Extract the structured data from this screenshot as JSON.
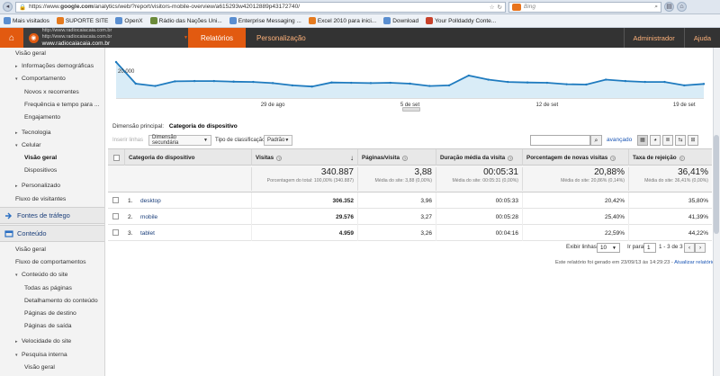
{
  "browser": {
    "url_prefix": "https://www.",
    "url_domain": "google.com",
    "url_rest": "/analytics/web/?report/visitors-mobile-overview/a615293w42012889p43172740/",
    "search_placeholder": "Bing",
    "bookmarks": [
      "Mais visitados",
      "SUPORTE SITE",
      "OpenX",
      "Rádio das Nações Uni...",
      "Enterprise Messaging ...",
      "Excel 2010 para inici...",
      "Download",
      "Your Polldaddy Conte..."
    ]
  },
  "ga": {
    "home_icon": "home-icon",
    "site_url_small": "http://www.radiocaiacaia.com.br  http://www.radiocaiacaia.com.br",
    "site_url": "www.radiocaiacaia.com.br",
    "tabs": [
      "Relatórios",
      "Personalização"
    ],
    "right": [
      "Administrador",
      "Ajuda"
    ]
  },
  "sidebar": {
    "items": [
      {
        "label": "Visão geral"
      },
      {
        "label": "Informações demográficas"
      },
      {
        "label": "Comportamento"
      },
      {
        "label": "Novos x recorrentes"
      },
      {
        "label": "Frequência e tempo para ..."
      },
      {
        "label": "Engajamento"
      },
      {
        "label": "Tecnologia"
      },
      {
        "label": "Celular"
      },
      {
        "label": "Visão geral"
      },
      {
        "label": "Dispositivos"
      },
      {
        "label": "Personalizado"
      },
      {
        "label": "Fluxo de visitantes"
      },
      {
        "label": "Fontes de tráfego"
      },
      {
        "label": "Conteúdo"
      },
      {
        "label": "Visão geral"
      },
      {
        "label": "Fluxo de comportamentos"
      },
      {
        "label": "Conteúdo do site"
      },
      {
        "label": "Todas as páginas"
      },
      {
        "label": "Detalhamento do conteúdo"
      },
      {
        "label": "Páginas de destino"
      },
      {
        "label": "Páginas de saída"
      },
      {
        "label": "Velocidade do site"
      },
      {
        "label": "Pesquisa interna"
      },
      {
        "label": "Visão geral"
      }
    ]
  },
  "chart_data": {
    "type": "line",
    "y_label_visible": "20.000",
    "x_ticks": [
      "29 de ago",
      "5 de set",
      "12 de set",
      "19 de set"
    ],
    "values": [
      22500,
      15000,
      14200,
      15800,
      15900,
      15900,
      15700,
      15600,
      15200,
      14400,
      14000,
      15400,
      15300,
      15200,
      15300,
      15000,
      14200,
      14400,
      17800,
      16400,
      15600,
      15400,
      15300,
      14800,
      14700,
      16400,
      15900,
      15600,
      15600,
      14400,
      14900
    ]
  },
  "controls": {
    "primary_dimension_label": "Dimensão principal:",
    "primary_dimension_value": "Categoria do dispositivo",
    "plot_rows": "Inserir linhas",
    "secondary_dim": "Dimensão secundária",
    "sort_label": "Tipo de classificação:",
    "sort_value": "Padrão",
    "advanced": "avançado"
  },
  "table": {
    "headers": [
      "Categoria do dispositivo",
      "Visitas",
      "Páginas/visita",
      "Duração média da visita",
      "Porcentagem de novas visitas",
      "Taxa de rejeição"
    ],
    "totals": [
      {
        "big": "340.887",
        "sub": "Porcentagem do total: 100,00% (340.887)"
      },
      {
        "big": "3,88",
        "sub": "Média do site: 3,88 (0,00%)"
      },
      {
        "big": "00:05:31",
        "sub": "Média do site: 00:05:31 (0,00%)"
      },
      {
        "big": "20,88%",
        "sub": "Média do site: 20,86% (0,14%)"
      },
      {
        "big": "36,41%",
        "sub": "Média do site: 36,41% (0,00%)"
      }
    ],
    "rows": [
      {
        "n": "1.",
        "cat": "desktop",
        "visits": "306.352",
        "ppv": "3,96",
        "dur": "00:05:33",
        "new": "20,42%",
        "bounce": "35,80%"
      },
      {
        "n": "2.",
        "cat": "mobile",
        "visits": "29.576",
        "ppv": "3,27",
        "dur": "00:05:28",
        "new": "25,40%",
        "bounce": "41,39%"
      },
      {
        "n": "3.",
        "cat": "tablet",
        "visits": "4.959",
        "ppv": "3,26",
        "dur": "00:04:16",
        "new": "22,59%",
        "bounce": "44,22%"
      }
    ]
  },
  "pager": {
    "show_rows_label": "Exibir linhas:",
    "show_rows_value": "10",
    "goto_label": "Ir para:",
    "goto_value": "1",
    "range": "1 - 3 de 3"
  },
  "footer": {
    "generated": "Este relatório foi gerado em 23/09/13 às 14:29:23 -",
    "refresh": "Atualizar relatório"
  }
}
